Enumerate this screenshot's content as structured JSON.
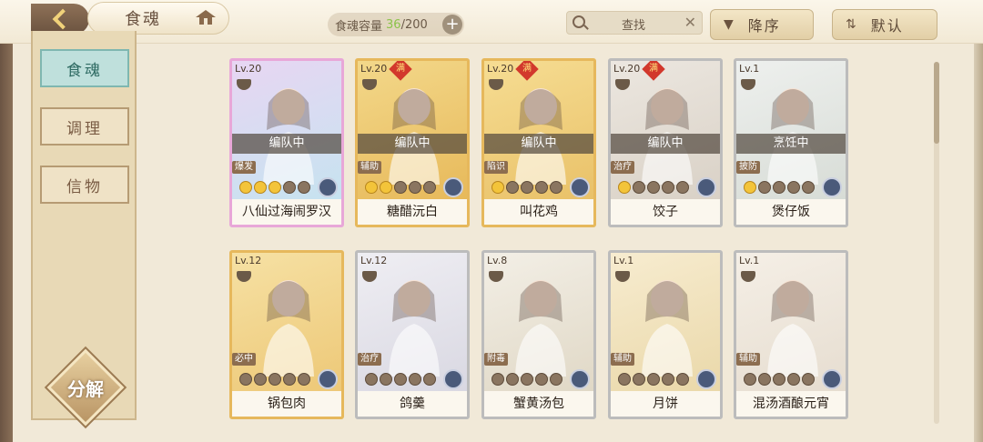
{
  "topbar": {
    "title": "食魂",
    "capacity_label": "食魂容量",
    "capacity_current": "36",
    "capacity_max": "/200",
    "capacity_plus": "+",
    "search_label": "查找",
    "search_clear": "✕",
    "sort_desc_label": "降序",
    "sort_desc_icon": "▼",
    "sort_default_label": "默认",
    "sort_default_icon": "⇅"
  },
  "sidebar": {
    "items": [
      {
        "label": "食魂",
        "active": true
      },
      {
        "label": "调理",
        "active": false
      },
      {
        "label": "信物",
        "active": false
      }
    ],
    "decompose_label": "分解"
  },
  "cards": [
    {
      "level": "Lv.20",
      "full": false,
      "status": "编队中",
      "role": "爆发",
      "stars": 5,
      "stars_on": 3,
      "name": "八仙过海闹罗汉",
      "frame": "rainbow",
      "palette": [
        "#e8d6f3",
        "#c6e3f0"
      ]
    },
    {
      "level": "Lv.20",
      "full": true,
      "status": "编队中",
      "role": "辅助",
      "stars": 5,
      "stars_on": 2,
      "name": "糖醋沅白",
      "frame": "gold",
      "palette": [
        "#f3d88a",
        "#e7b95a"
      ]
    },
    {
      "level": "Lv.20",
      "full": true,
      "status": "编队中",
      "role": "陷识",
      "stars": 5,
      "stars_on": 1,
      "name": "叫花鸡",
      "frame": "gold",
      "palette": [
        "#f6dd93",
        "#e9c168"
      ]
    },
    {
      "level": "Lv.20",
      "full": true,
      "status": "编队中",
      "role": "治疗",
      "stars": 5,
      "stars_on": 1,
      "name": "饺子",
      "frame": "silver",
      "palette": [
        "#ece7e0",
        "#d9d1c6"
      ]
    },
    {
      "level": "Lv.1",
      "full": false,
      "status": "烹饪中",
      "role": "披防",
      "stars": 5,
      "stars_on": 1,
      "name": "煲仔饭",
      "frame": "silver",
      "palette": [
        "#eef0ee",
        "#d7dcd6"
      ]
    },
    {
      "level": "Lv.12",
      "full": false,
      "status": "",
      "role": "必中",
      "stars": 5,
      "stars_on": 0,
      "name": "锅包肉",
      "frame": "gold",
      "palette": [
        "#f6e1a4",
        "#edc877"
      ]
    },
    {
      "level": "Lv.12",
      "full": false,
      "status": "",
      "role": "治疗",
      "stars": 5,
      "stars_on": 0,
      "name": "鸽羹",
      "frame": "silver",
      "palette": [
        "#efeef3",
        "#d9d8e2"
      ]
    },
    {
      "level": "Lv.8",
      "full": false,
      "status": "",
      "role": "附毒",
      "stars": 5,
      "stars_on": 0,
      "name": "蟹黄汤包",
      "frame": "silver",
      "palette": [
        "#f3efe6",
        "#e0d8c6"
      ]
    },
    {
      "level": "Lv.1",
      "full": false,
      "status": "",
      "role": "辅助",
      "stars": 5,
      "stars_on": 0,
      "name": "月饼",
      "frame": "silver",
      "palette": [
        "#f7ecd0",
        "#ead8a9"
      ]
    },
    {
      "level": "Lv.1",
      "full": false,
      "status": "",
      "role": "辅助",
      "stars": 5,
      "stars_on": 0,
      "name": "混汤酒酿元宵",
      "frame": "silver",
      "palette": [
        "#f5efe6",
        "#e6ddd0"
      ]
    }
  ],
  "full_badge": "满"
}
